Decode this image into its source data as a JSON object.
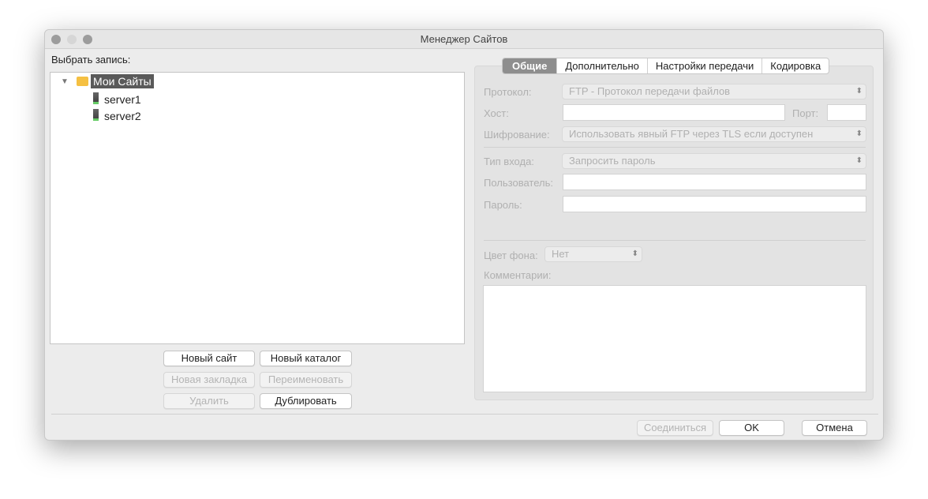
{
  "window": {
    "title": "Менеджер Сайтов"
  },
  "left": {
    "label": "Выбрать запись:",
    "tree": {
      "root": "Мои Сайты",
      "children": [
        "server1",
        "server2"
      ]
    },
    "buttons": {
      "new_site": "Новый сайт",
      "new_folder": "Новый каталог",
      "new_bookmark": "Новая закладка",
      "rename": "Переименовать",
      "delete": "Удалить",
      "duplicate": "Дублировать"
    }
  },
  "tabs": [
    "Общие",
    "Дополнительно",
    "Настройки передачи",
    "Кодировка"
  ],
  "form": {
    "protocol_label": "Протокол:",
    "protocol_value": "FTP - Протокол передачи файлов",
    "host_label": "Хост:",
    "host_value": "",
    "port_label": "Порт:",
    "port_value": "",
    "encryption_label": "Шифрование:",
    "encryption_value": "Использовать явный FTP через TLS если доступен",
    "logon_label": "Тип входа:",
    "logon_value": "Запросить пароль",
    "user_label": "Пользователь:",
    "user_value": "",
    "password_label": "Пароль:",
    "password_value": "",
    "bgcolor_label": "Цвет фона:",
    "bgcolor_value": "Нет",
    "comments_label": "Комментарии:",
    "comments_value": ""
  },
  "footer": {
    "connect": "Соединиться",
    "ok": "OK",
    "cancel": "Отмена"
  }
}
